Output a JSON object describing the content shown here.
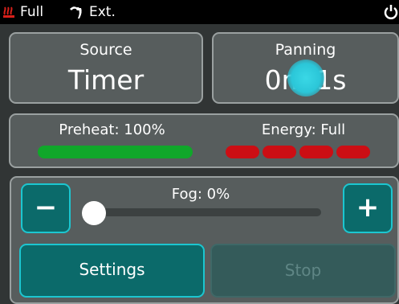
{
  "status_bar": {
    "heat_mode": "Full",
    "fan_mode": "Ext.",
    "icons": [
      "heater-icon",
      "fan-icon",
      "power-icon"
    ],
    "colors": {
      "heater": "#d8201a",
      "text": "#ffffff"
    }
  },
  "source_card": {
    "label": "Source",
    "value": "Timer"
  },
  "running_card": {
    "label": "Panning",
    "value": "0m 1s"
  },
  "status_card": {
    "preheat_label": "Preheat: 100%",
    "preheat_percent": 100,
    "energy_label": "Energy: Full",
    "energy_segments": 4,
    "colors": {
      "preheat": "#10a72a",
      "energy": "#cc0e14"
    }
  },
  "fog_control": {
    "label": "Fog: 0%",
    "value_percent": 0,
    "minus_label": "−",
    "plus_label": "+"
  },
  "buttons": {
    "settings_label": "Settings",
    "stop_label": "Stop"
  },
  "colors": {
    "accent": "#1cc6d0",
    "button_fill": "#0b6a6a",
    "card_fill": "#575d5d",
    "background": "#313535"
  }
}
